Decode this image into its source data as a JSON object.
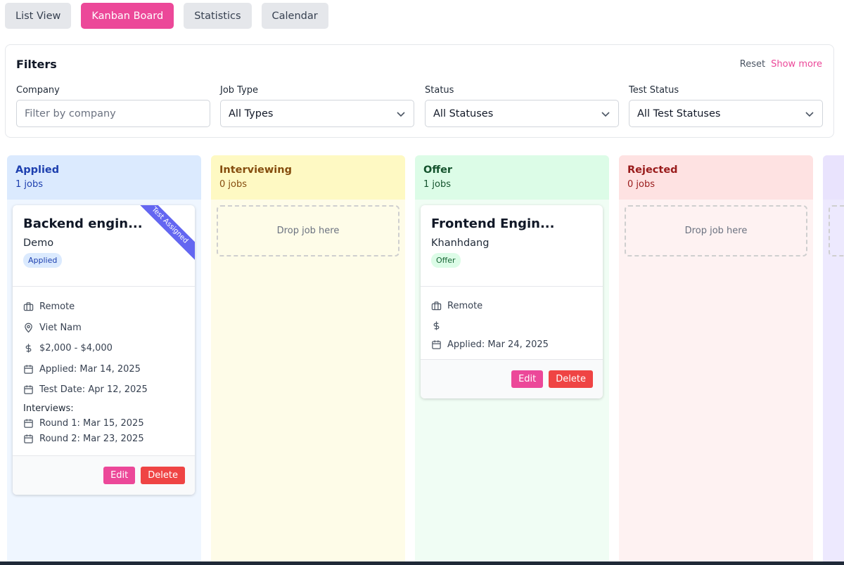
{
  "view_tabs": [
    {
      "label": "List View",
      "active": false
    },
    {
      "label": "Kanban Board",
      "active": true
    },
    {
      "label": "Statistics",
      "active": false
    },
    {
      "label": "Calendar",
      "active": false
    }
  ],
  "filters": {
    "title": "Filters",
    "reset_label": "Reset",
    "show_more_label": "Show more",
    "company": {
      "label": "Company",
      "placeholder": "Filter by company"
    },
    "job_type": {
      "label": "Job Type",
      "value": "All Types"
    },
    "status": {
      "label": "Status",
      "value": "All Statuses"
    },
    "test_status": {
      "label": "Test Status",
      "value": "All Test Statuses"
    }
  },
  "columns": [
    {
      "title": "Applied",
      "count": "1 jobs",
      "head_bg": "#dbeafe",
      "body_bg": "#eff6ff",
      "title_color": "#1e40af"
    },
    {
      "title": "Interviewing",
      "count": "0 jobs",
      "head_bg": "#fef9c3",
      "body_bg": "#fefce8",
      "title_color": "#854d0e",
      "drop_label": "Drop job here"
    },
    {
      "title": "Offer",
      "count": "1 jobs",
      "head_bg": "#dcfce7",
      "body_bg": "#f0fdf4",
      "title_color": "#14532d"
    },
    {
      "title": "Rejected",
      "count": "0 jobs",
      "head_bg": "#fee2e2",
      "body_bg": "#fef2f2",
      "title_color": "#991b1b",
      "drop_label": "Drop job here"
    }
  ],
  "cards": {
    "backend": {
      "title": "Backend engin...",
      "company": "Demo",
      "status": "Applied",
      "ribbon": "Test Assigned",
      "work_mode": "Remote",
      "location": "Viet Nam",
      "salary": "$2,000 - $4,000",
      "applied": "Applied: Mar 14, 2025",
      "test_date": "Test Date: Apr 12, 2025",
      "interviews_label": "Interviews:",
      "interviews": [
        "Round 1: Mar 15, 2025",
        "Round 2: Mar 23, 2025"
      ],
      "edit_label": "Edit",
      "delete_label": "Delete"
    },
    "frontend": {
      "title": "Frontend Engin...",
      "company": "Khanhdang",
      "status": "Offer",
      "work_mode": "Remote",
      "salary": "",
      "applied": "Applied: Mar 24, 2025",
      "edit_label": "Edit",
      "delete_label": "Delete"
    }
  },
  "colors": {
    "accent": "#ec4899",
    "danger": "#ef4444",
    "ribbon": "#6366f1"
  }
}
